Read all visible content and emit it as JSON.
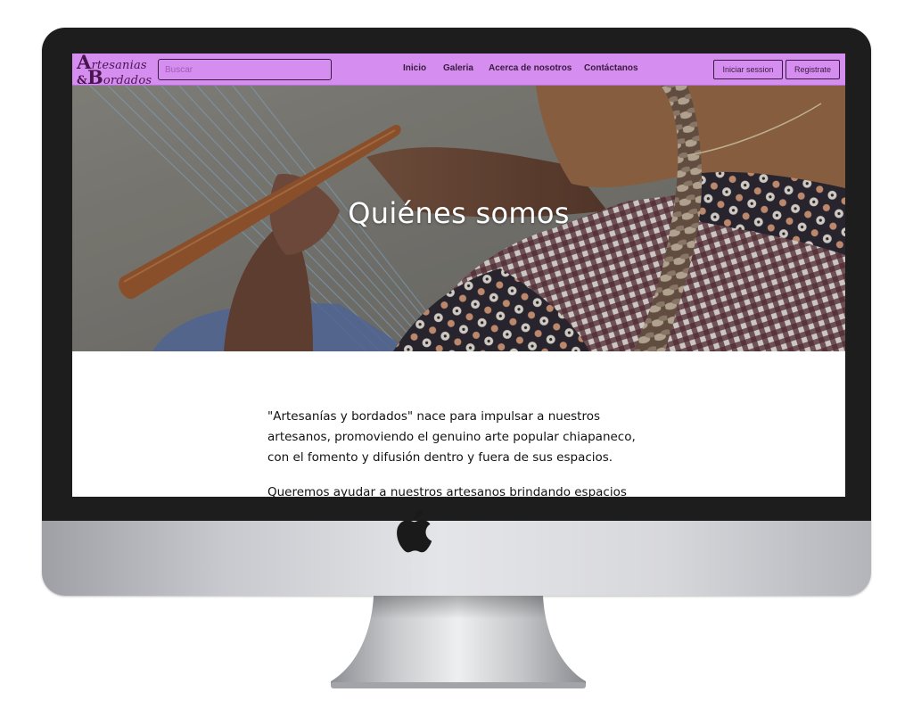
{
  "navbar": {
    "logo": {
      "line1_cap": "A",
      "line1_rest": "rtesanias",
      "line2_amp": "&",
      "line2_cap": "B",
      "line2_rest": "ordados"
    },
    "search_placeholder": "Buscar",
    "links": [
      "Inicio",
      "Galeria",
      "Acerca de nosotros",
      "Contáctanos"
    ],
    "login_label": "Iniciar session",
    "register_label": "Registrate"
  },
  "hero": {
    "title": "Quiénes somos"
  },
  "content": {
    "paragraphs": [
      "\"Artesanías y bordados\" nace para impulsar a nuestros artesanos, promoviendo el genuino arte popular chiapaneco, con el fomento y difusión dentro y fuera de sus espacios.",
      "Queremos ayudar a nuestros artesanos brindando espacios"
    ]
  },
  "colors": {
    "navbar_bg": "#d58ef0",
    "navbar_text": "#3a1a3e",
    "logo_text": "#4a1450",
    "bezel": "#1d1d1d"
  },
  "icons": {
    "device_logo": "apple-icon"
  }
}
